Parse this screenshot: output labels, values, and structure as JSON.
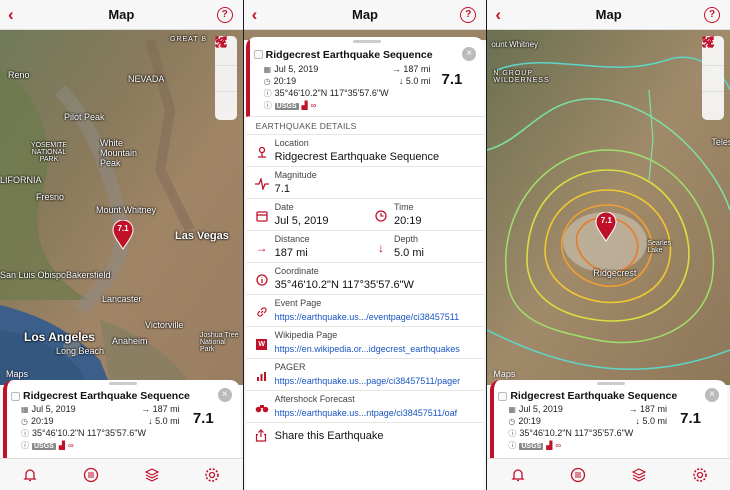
{
  "nav": {
    "title": "Map",
    "back_icon": "‹",
    "help_icon": "?"
  },
  "colors": {
    "accent": "#c0112b",
    "link": "#1a56c0"
  },
  "map_left": {
    "labels": {
      "nevada": "NEVADA",
      "reno": "Reno",
      "great_basin": "GREAT B",
      "pilot_peak": "Pilot Peak",
      "yosemite": "YOSEMITE NATIONAL PARK",
      "white_mountain": "White Mountain Peak",
      "california": "LIFORNIA",
      "fresno": "Fresno",
      "mount_whitney": "Mount Whitney",
      "las_vegas": "Las Vegas",
      "san_luis": "San Luis Obispo",
      "bakersfield": "Bakersfield",
      "lancaster": "Lancaster",
      "victorville": "Victorville",
      "los_angeles": "Los Angeles",
      "long_beach": "Long Beach",
      "anaheim": "Anaheim",
      "joshua_tree": "Joshua Tree National Park",
      "apple_maps": "Maps"
    },
    "pin": "7.1"
  },
  "map_right": {
    "labels": {
      "whitney": "ount Whitney",
      "groom": "N GROUP WILDERNESS",
      "telesc": "Telesc",
      "searles": "Searles Lake",
      "ridgecrest": "Ridgecrest",
      "apple_maps": "Maps"
    },
    "pin": "7.1"
  },
  "summary": {
    "title": "Ridgecrest Earthquake Sequence",
    "date": "Jul 5, 2019",
    "time": "20:19",
    "coordinate": "35°46'10.2\"N 117°35'57.6\"W",
    "distance": "187 mi",
    "depth": "5.0 mi",
    "magnitude": "7.1",
    "source": "USGS"
  },
  "details": {
    "section_title": "EARTHQUAKE DETAILS",
    "location_label": "Location",
    "location": "Ridgecrest Earthquake Sequence",
    "magnitude_label": "Magnitude",
    "magnitude": "7.1",
    "date_label": "Date",
    "date": "Jul 5, 2019",
    "time_label": "Time",
    "time": "20:19",
    "distance_label": "Distance",
    "distance": "187 mi",
    "depth_label": "Depth",
    "depth": "5.0 mi",
    "coordinate_label": "Coordinate",
    "coordinate": "35°46'10.2\"N 117°35'57.6\"W",
    "event_label": "Event Page",
    "event_link": "https://earthquake.us.../eventpage/ci38457511",
    "wiki_label": "Wikipedia Page",
    "wiki_link": "https://en.wikipedia.or...idgecrest_earthquakes",
    "pager_label": "PAGER",
    "pager_link": "https://earthquake.us...page/ci38457511/pager",
    "aftershock_label": "Aftershock Forecast",
    "aftershock_link": "https://earthquake.us...ntpage/ci38457511/oaf",
    "share_label": "Share this Earthquake"
  }
}
